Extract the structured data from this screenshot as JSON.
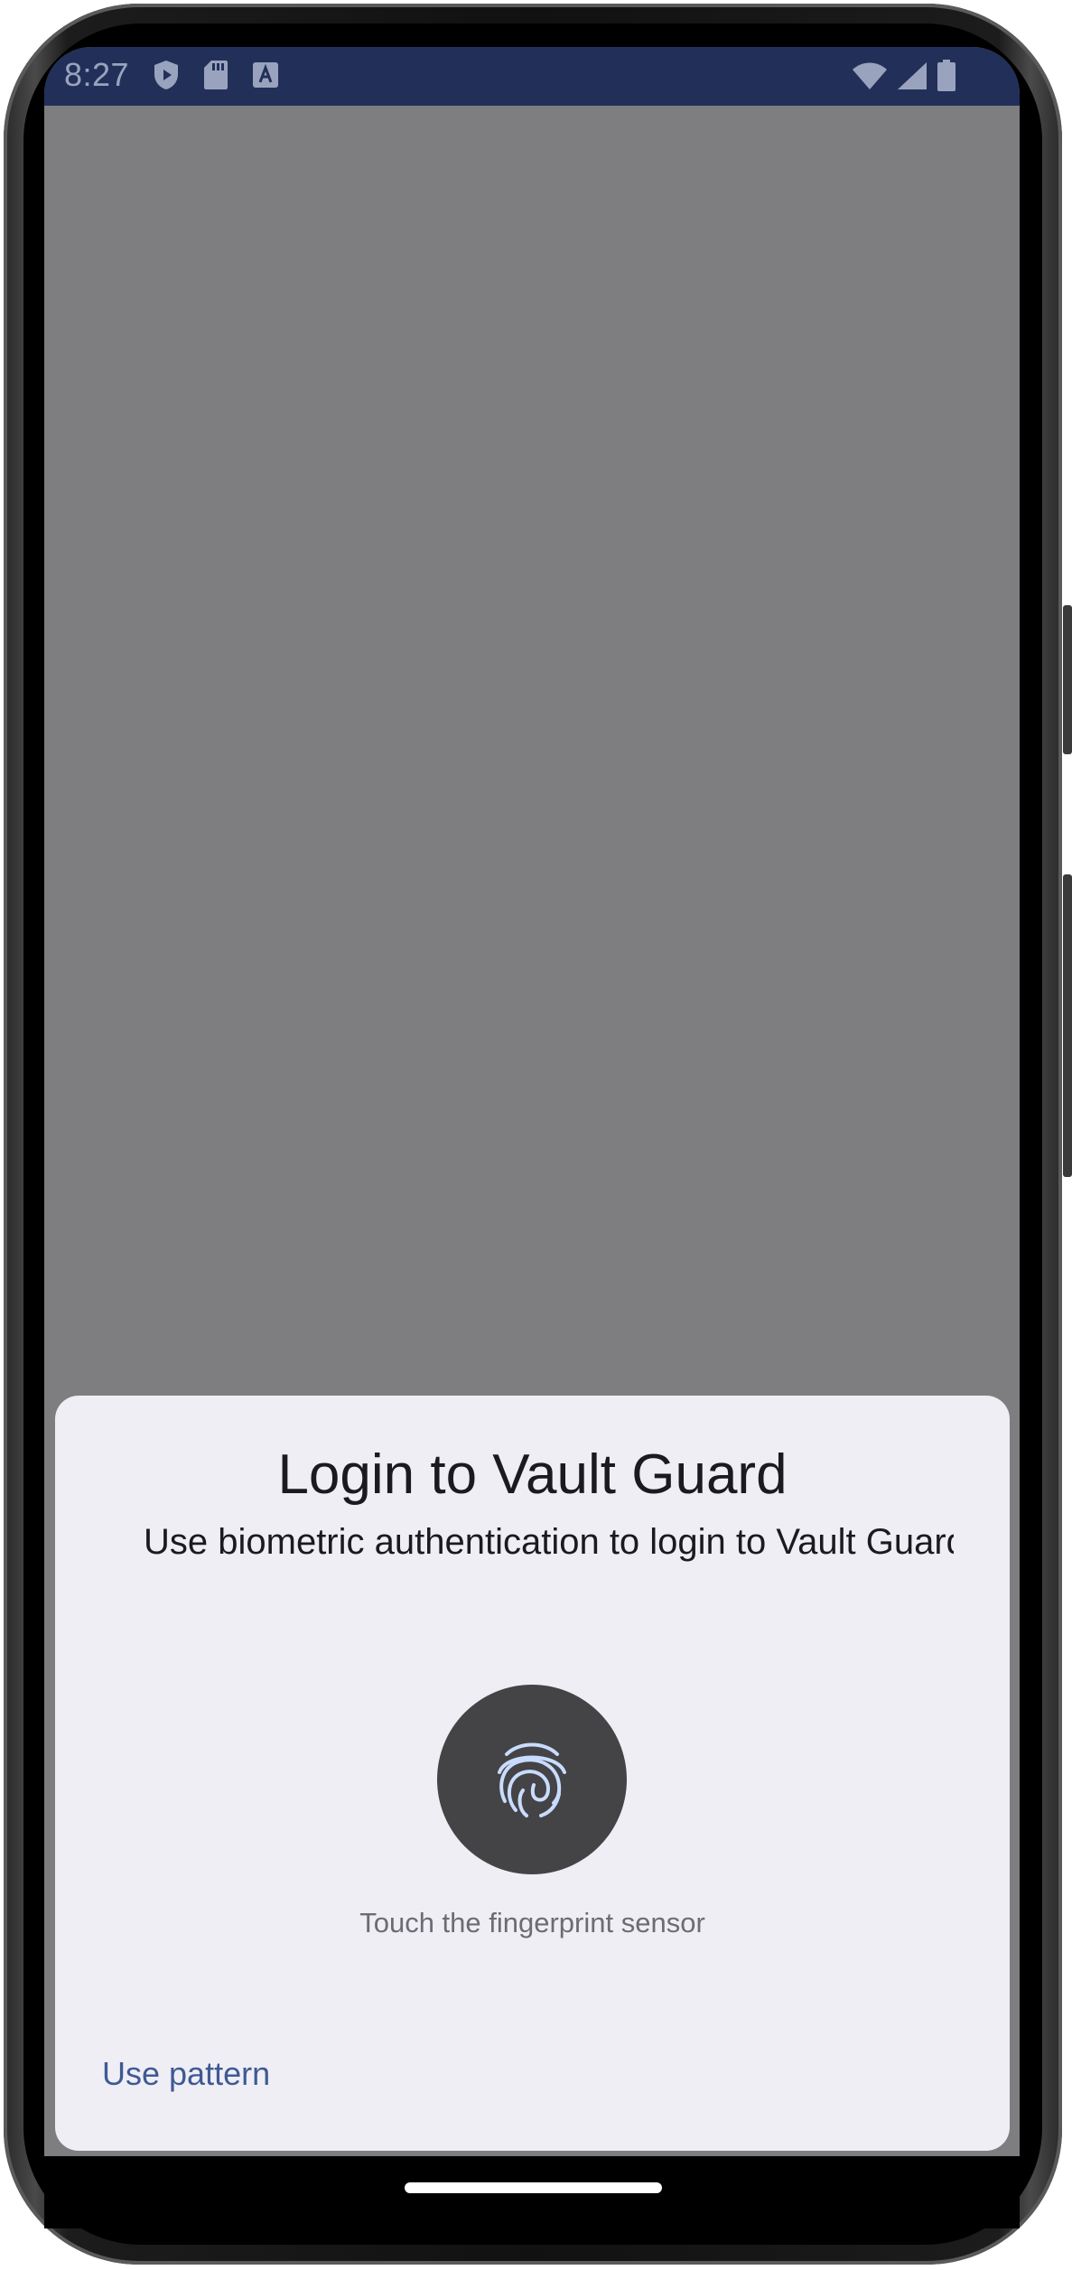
{
  "status_bar": {
    "time": "8:27",
    "left_icons": [
      "shield-play-icon",
      "sd-card-icon",
      "keyboard-a-icon"
    ],
    "right_icons": [
      "wifi-icon",
      "cell-signal-icon",
      "battery-icon"
    ]
  },
  "dialog": {
    "title": "Login to Vault Guard",
    "subtitle": "Use biometric authentication to login to Vault Guard",
    "icon": "fingerprint-icon",
    "hint": "Touch the fingerprint sensor",
    "alt_button_label": "Use pattern"
  },
  "colors": {
    "status_bar_bg": "#223059",
    "scrim": "#7e7e80",
    "dialog_bg": "#efeef5",
    "fingerprint_circle": "#444446",
    "fingerprint_stroke": "#c9dcff",
    "link": "#3e5a94"
  }
}
